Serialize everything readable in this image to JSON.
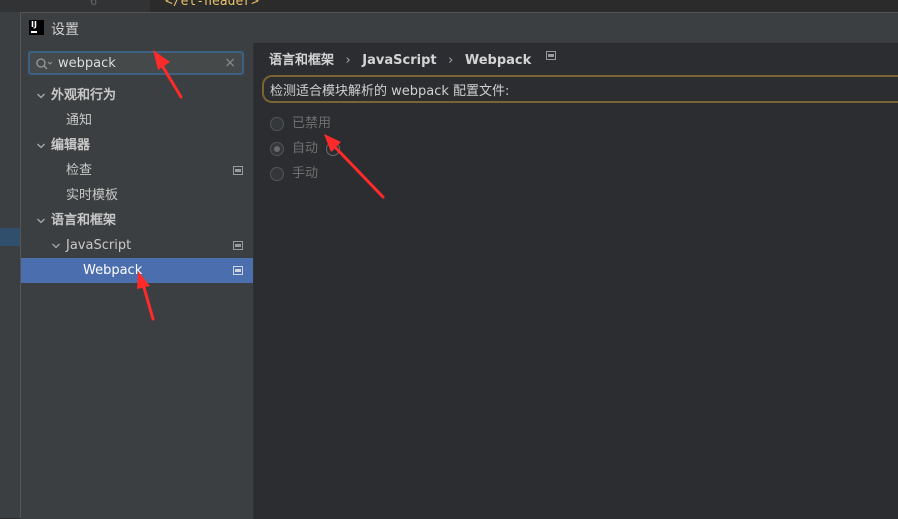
{
  "background": {
    "line_number": "6",
    "code_text": "</el-header>"
  },
  "window": {
    "title": "设置",
    "logo_text": "IJ"
  },
  "search": {
    "value": "webpack",
    "clear_glyph": "×"
  },
  "tree": {
    "items": [
      {
        "label": "外观和行为",
        "expanded": true,
        "bold": true
      },
      {
        "label": "通知"
      },
      {
        "label": "编辑器",
        "expanded": true,
        "bold": true
      },
      {
        "label": "检查",
        "project_scoped": true
      },
      {
        "label": "实时模板"
      },
      {
        "label": "语言和框架",
        "expanded": true,
        "bold": true
      },
      {
        "label": "JavaScript",
        "expanded": true,
        "project_scoped": true
      },
      {
        "label": "Webpack",
        "selected": true,
        "project_scoped": true
      }
    ]
  },
  "breadcrumb": {
    "items": [
      "语言和框架",
      "JavaScript",
      "Webpack"
    ],
    "separator": "›"
  },
  "webpack_settings": {
    "detect_label": "检测适合模块解析的 webpack 配置文件:",
    "options": [
      {
        "label": "已禁用",
        "checked": false
      },
      {
        "label": "自动",
        "checked": true,
        "help": "?"
      },
      {
        "label": "手动",
        "checked": false
      }
    ]
  },
  "colors": {
    "selection": "#4b6eaf",
    "annotation_arrow": "#ff2a2a",
    "search_border": "#3d6185",
    "highlight_border": "#7b6434"
  }
}
